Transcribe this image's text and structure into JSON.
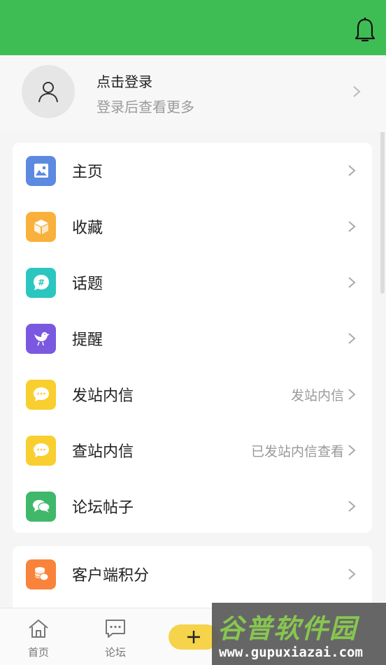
{
  "header": {
    "bell_icon": "bell-icon",
    "color": "#3fbd55"
  },
  "profile": {
    "title": "点击登录",
    "subtitle": "登录后查看更多",
    "avatar_icon": "user-icon"
  },
  "menu": [
    {
      "label": "主页",
      "value": "",
      "icon": "image-icon",
      "color": "#5b8ae0"
    },
    {
      "label": "收藏",
      "value": "",
      "icon": "box-icon",
      "color": "#f9b13b"
    },
    {
      "label": "话题",
      "value": "",
      "icon": "hashtag-chat-icon",
      "color": "#2cc6c0"
    },
    {
      "label": "提醒",
      "value": "",
      "icon": "bird-icon",
      "color": "#7b58e0"
    },
    {
      "label": "发站内信",
      "value": "发站内信",
      "icon": "message-icon",
      "color": "#f8cf2e"
    },
    {
      "label": "查站内信",
      "value": "已发站内信查看",
      "icon": "message-icon",
      "color": "#f8cf2e"
    },
    {
      "label": "论坛帖子",
      "value": "",
      "icon": "chat-bubbles-icon",
      "color": "#3fb86a"
    }
  ],
  "menu2": [
    {
      "label": "客户端积分",
      "value": "",
      "icon": "coins-icon",
      "color": "#f9833a"
    }
  ],
  "tabbar": {
    "home_label": "首页",
    "forum_label": "论坛",
    "plus_icon": "plus-icon",
    "accent": "#f5d34a"
  },
  "watermark": {
    "title": "谷普软件园",
    "url": "www.gupuxiazai.com"
  }
}
